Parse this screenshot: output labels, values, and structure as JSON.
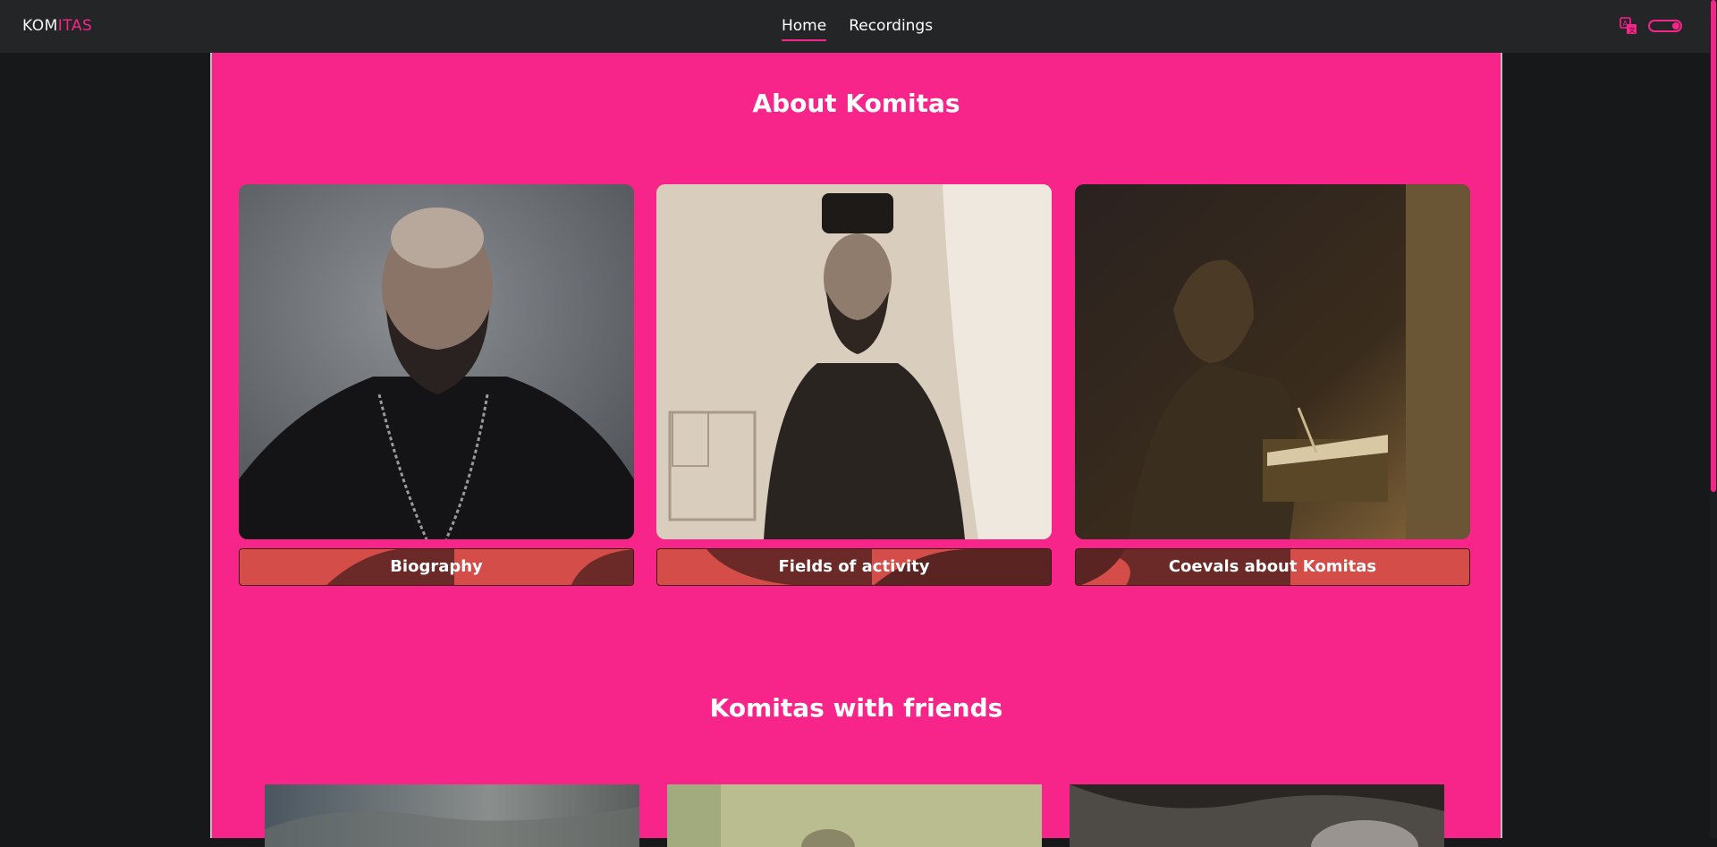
{
  "header": {
    "logo_main": "KOM",
    "logo_accent": "ITAS",
    "nav": [
      {
        "label": "Home",
        "active": true
      },
      {
        "label": "Recordings",
        "active": false
      }
    ],
    "translate_icon": "translate-icon",
    "theme_toggle_icon": "theme-toggle-icon"
  },
  "colors": {
    "accent": "#f7258a",
    "topbar": "#242527",
    "background": "#17181a",
    "button": "#d44d48"
  },
  "about": {
    "title": "About Komitas",
    "cards": [
      {
        "label": "Biography"
      },
      {
        "label": "Fields of activity"
      },
      {
        "label": "Coevals about Komitas"
      }
    ]
  },
  "friends": {
    "title": "Komitas with friends"
  }
}
